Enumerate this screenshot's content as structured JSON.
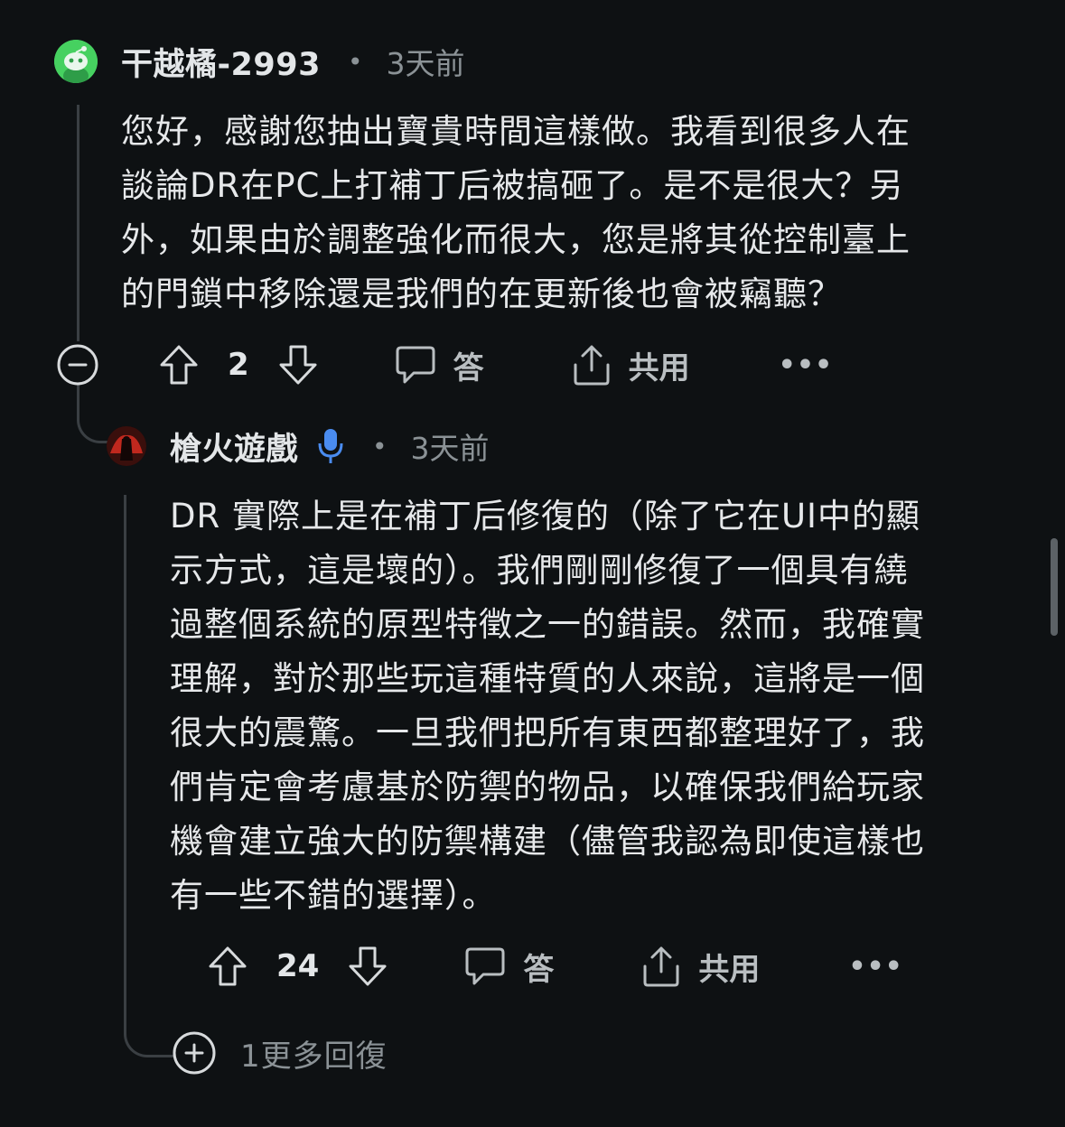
{
  "comment1": {
    "username": "干越橘-2993",
    "separator": "•",
    "time": "3天前",
    "lines": [
      "您好，感謝您抽出寶貴時間這樣做。我看到很多人在",
      "談論DR在PC上打補丁后被搞砸了。是不是很大？另",
      "外，如果由於調整強化而很大，您是將其從控制臺上",
      "的門鎖中移除還是我們的在更新後也會被竊聽？"
    ],
    "votes": "2",
    "reply_label": "答",
    "share_label": "共用",
    "more": "•••"
  },
  "comment2": {
    "username": "槍火遊戲",
    "separator": "•",
    "time": "3天前",
    "lines": [
      "DR 實際上是在補丁后修復的（除了它在UI中的顯",
      "示方式，這是壞的）。我們剛剛修復了一個具有繞",
      "過整個系統的原型特徵之一的錯誤。然而，我確實",
      "理解，對於那些玩這種特質的人來說，這將是一個",
      "很大的震驚。一旦我們把所有東西都整理好了，我",
      "們肯定會考慮基於防禦的物品，以確保我們給玩家",
      "機會建立強大的防禦構建（儘管我認為即使這樣也",
      "有一些不錯的選擇）。"
    ],
    "votes": "24",
    "reply_label": "答",
    "share_label": "共用",
    "more": "•••"
  },
  "more_replies_label": "1更多回復",
  "colors": {
    "background": "#0e1113",
    "mod_badge": "#4a8cf0",
    "avatar_green": "#46d160"
  }
}
